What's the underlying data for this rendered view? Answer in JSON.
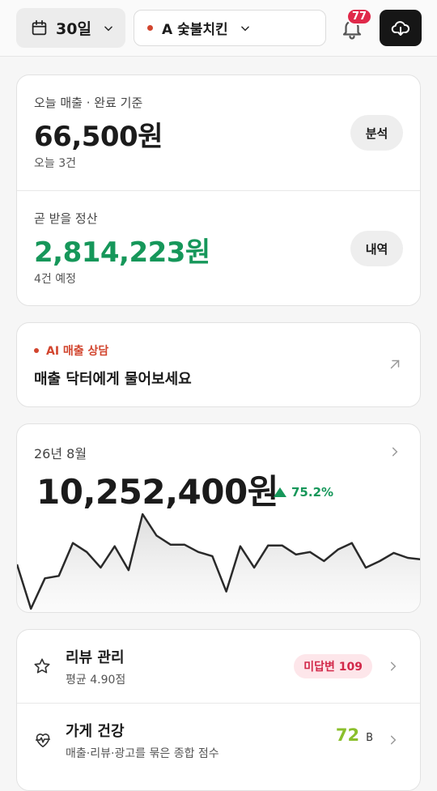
{
  "topbar": {
    "period_label": "30일",
    "store_name": "A 숯불치킨",
    "notification_count": "77"
  },
  "sales_today": {
    "label": "오늘 매출 · 완료 기준",
    "value": "66,500원",
    "sub": "오늘 3건",
    "button": "분석"
  },
  "settlement": {
    "label": "곧 받을 정산",
    "value": "2,814,223원",
    "sub": "4건 예정",
    "button": "내역"
  },
  "ai": {
    "tag": "AI 매출 상담",
    "title": "매출 닥터에게 물어보세요"
  },
  "monthly": {
    "label": "26년 8월",
    "value": "10,252,400원",
    "delta": "75.2%"
  },
  "chart_data": {
    "type": "area",
    "values": [
      60,
      6,
      43,
      46,
      86,
      75,
      56,
      82,
      53,
      121,
      95,
      84,
      84,
      75,
      70,
      27,
      82,
      56,
      83,
      83,
      72,
      75,
      64,
      78,
      86,
      56,
      64,
      74,
      68,
      66
    ],
    "ylim": [
      0,
      130
    ],
    "grid": false
  },
  "rows": [
    {
      "title": "리뷰 관리",
      "sub": "평균 4.90점",
      "badge": "미답변 109"
    },
    {
      "title": "가게 건강",
      "sub": "매출·리뷰·광고를 묶은 종합 점수",
      "score": "72",
      "grade": "B"
    }
  ]
}
